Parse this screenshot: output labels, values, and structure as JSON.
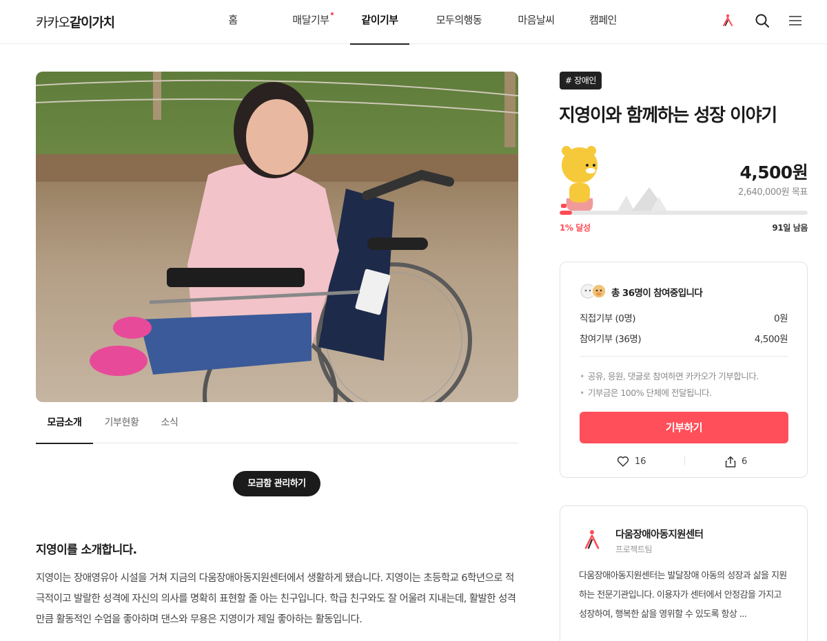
{
  "header": {
    "logo_light": "카카오",
    "logo_bold": "같이가치",
    "nav": [
      {
        "label": "홈"
      },
      {
        "label": "매달기부",
        "has_dot": true
      },
      {
        "label": "같이기부",
        "active": true
      },
      {
        "label": "모두의행동"
      },
      {
        "label": "마음날씨"
      },
      {
        "label": "캠페인"
      }
    ],
    "icons": [
      "brand-person-icon",
      "search-icon",
      "menu-icon"
    ],
    "accent_color": "#ff4b55"
  },
  "hero": {
    "image": "photo of a girl in a pink sweater sitting in a wheelchair on a dirt path"
  },
  "tabs": [
    {
      "label": "모금소개",
      "active": true
    },
    {
      "label": "기부현황"
    },
    {
      "label": "소식"
    }
  ],
  "manage_button": "모금함 관리하기",
  "intro": {
    "title": "지영이를 소개합니다.",
    "body": "지영이는 장애영유아 시설을 거쳐 지금의 다움장애아동지원센터에서 생활하게 됐습니다. 지영이는 초등학교 6학년으로 적극적이고 발랄한 성격에 자신의 의사를 명확히 표현할 줄 아는 친구입니다. 학급 친구와도 잘 어울려 지내는데, 활발한 성격만큼 활동적인 수업을 좋아하며 댄스와 무용은 지영이가 제일 좋아하는 활동입니다."
  },
  "campaign": {
    "tag": "# 장애인",
    "title": "지영이와 함께하는 성장 이야기",
    "raised": "4,500원",
    "goal": "2,640,000원 목표",
    "progress_percent": 1,
    "progress_label": "1% 달성",
    "days_left": "91일 남음"
  },
  "donate_card": {
    "participants": "총 36명이 참여중입니다",
    "rows": [
      {
        "label": "직접기부 (0명)",
        "value": "0원"
      },
      {
        "label": "참여기부 (36명)",
        "value": "4,500원"
      }
    ],
    "notes": [
      "공유, 응원, 댓글로 참여하면 카카오가 기부합니다.",
      "기부금은 100% 단체에 전달됩니다."
    ],
    "donate_button": "기부하기",
    "likes": "16",
    "shares": "6",
    "button_color": "#ff4f5a"
  },
  "org": {
    "name": "다움장애아동지원센터",
    "role": "프로젝트팀",
    "description": "다움장애아동지원센터는 발달장애 아동의 성장과 삶을 지원하는 전문기관입니다. 이용자가 센터에서 안정감을 가지고 성장하여, 행복한 삶을 영위할 수 있도록 항상 ..."
  }
}
